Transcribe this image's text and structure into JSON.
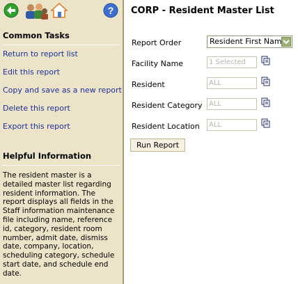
{
  "toolbar": {
    "icons": [
      "back-icon",
      "users-icon",
      "home-icon",
      "help-icon"
    ],
    "help_label": "?"
  },
  "sidebar": {
    "common_tasks_title": "Common Tasks",
    "tasks": [
      "Return to report list",
      "Edit this report",
      "Copy and save as a new report",
      "Delete this report",
      "Export this report"
    ],
    "helpful_title": "Helpful Information",
    "helpful_text": "The resident master is a detailed master list regarding resident information. The report displays all fields in the Staff information maintenance file including name, reference id, category, resident room number, admit date, dismiss date, company, location, scheduling category, schedule start date, and schedule end date."
  },
  "main": {
    "title": "CORP - Resident Master List",
    "fields": {
      "report_order": {
        "label": "Report Order",
        "value": "Resident First Name"
      },
      "facility_name": {
        "label": "Facility Name",
        "value": "1 Selected"
      },
      "resident": {
        "label": "Resident",
        "value": "ALL"
      },
      "resident_category": {
        "label": "Resident Category",
        "value": "ALL"
      },
      "resident_location": {
        "label": "Resident Location",
        "value": "ALL"
      }
    },
    "run_button": "Run Report"
  },
  "colors": {
    "sidebar_bg": "#ece4c8",
    "link": "#1c2f9a",
    "select_arrow": "#9bb37a"
  }
}
